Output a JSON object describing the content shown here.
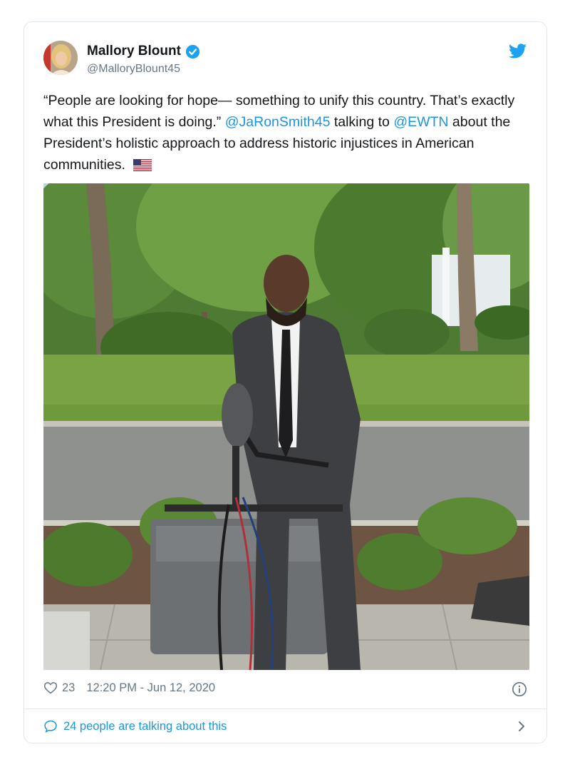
{
  "author": {
    "name": "Mallory Blount",
    "handle": "@MalloryBlount45",
    "verified": true
  },
  "tweet": {
    "text_part1": "“People are looking for hope— something to unify this country. That’s exactly what this President is doing.” ",
    "mention1": "@JaRonSmith45",
    "text_part2": " talking to ",
    "mention2": "@EWTN",
    "text_part3": " about the President’s holistic approach to address historic injustices in American communities. ",
    "emoji": "us-flag-icon"
  },
  "footer": {
    "likes": "23",
    "timestamp": "12:20 PM - Jun 12, 2020",
    "talking": "24 people are talking about this"
  },
  "colors": {
    "link": "#1b95e0",
    "secondary": "#657786",
    "border": "#e1e8ed"
  }
}
